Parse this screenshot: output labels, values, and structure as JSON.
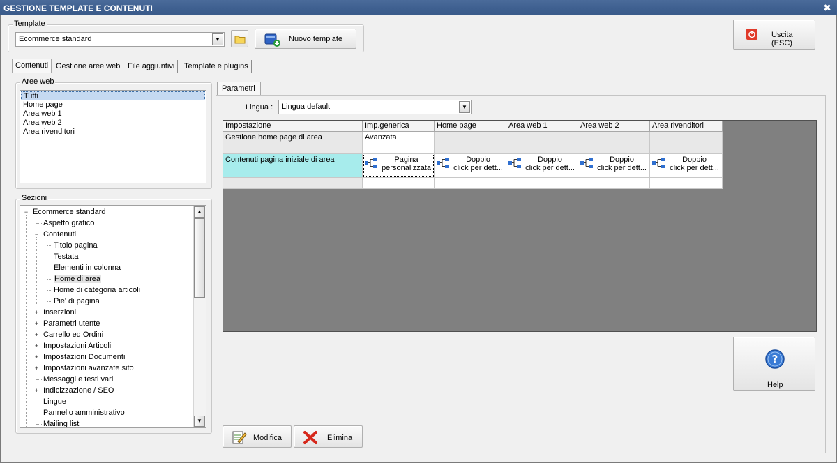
{
  "window": {
    "title": "GESTIONE TEMPLATE E CONTENUTI",
    "close_glyph": "✖"
  },
  "template_group": {
    "title": "Template",
    "selected": "Ecommerce standard",
    "new_button": "Nuovo template"
  },
  "exit_button": "Uscita (ESC)",
  "tabs": [
    "Contenuti",
    "Gestione aree web",
    "File aggiuntivi",
    "Template e plugins"
  ],
  "aree_web": {
    "title": "Aree web",
    "items": [
      "Tutti",
      "Home page",
      "Area web 1",
      "Area web 2",
      "Area rivenditori"
    ]
  },
  "sezioni": {
    "title": "Sezioni",
    "items": [
      {
        "label": "Ecommerce standard",
        "level": 0,
        "toggle": "−"
      },
      {
        "label": "Aspetto grafico",
        "level": 1,
        "toggle": ""
      },
      {
        "label": "Contenuti",
        "level": 1,
        "toggle": "−"
      },
      {
        "label": "Titolo pagina",
        "level": 2,
        "toggle": ""
      },
      {
        "label": "Testata",
        "level": 2,
        "toggle": ""
      },
      {
        "label": "Elementi in colonna",
        "level": 2,
        "toggle": ""
      },
      {
        "label": "Home di area",
        "level": 2,
        "toggle": "",
        "selected": true
      },
      {
        "label": "Home di categoria articoli",
        "level": 2,
        "toggle": ""
      },
      {
        "label": "Pie' di pagina",
        "level": 2,
        "toggle": ""
      },
      {
        "label": "Inserzioni",
        "level": 1,
        "toggle": "+"
      },
      {
        "label": "Parametri utente",
        "level": 1,
        "toggle": "+"
      },
      {
        "label": "Carrello ed Ordini",
        "level": 1,
        "toggle": "+"
      },
      {
        "label": "Impostazioni Articoli",
        "level": 1,
        "toggle": "+"
      },
      {
        "label": "Impostazioni Documenti",
        "level": 1,
        "toggle": "+"
      },
      {
        "label": "Impostazioni avanzate sito",
        "level": 1,
        "toggle": "+"
      },
      {
        "label": "Messaggi e testi vari",
        "level": 1,
        "toggle": ""
      },
      {
        "label": "Indicizzazione / SEO",
        "level": 1,
        "toggle": "+"
      },
      {
        "label": "Lingue",
        "level": 1,
        "toggle": ""
      },
      {
        "label": "Pannello amministrativo",
        "level": 1,
        "toggle": ""
      },
      {
        "label": "Mailing list",
        "level": 1,
        "toggle": ""
      }
    ]
  },
  "parametri": {
    "tab": "Parametri",
    "lingua_label": "Lingua :",
    "lingua_value": "Lingua default",
    "columns": [
      "Impostazione",
      "Imp.generica",
      "Home page",
      "Area web 1",
      "Area web 2",
      "Area rivenditori"
    ],
    "rows": [
      {
        "setting": "Gestione home page di area",
        "generic": "Avanzata"
      },
      {
        "setting": "Contenuti pagina iniziale di area",
        "generic_line1": "Pagina",
        "generic_line2": "personalizzata",
        "area_line1": "Doppio",
        "area_line2": "click per dett..."
      }
    ]
  },
  "help_button": "Help",
  "modifica_button": "Modifica",
  "elimina_button": "Elimina"
}
